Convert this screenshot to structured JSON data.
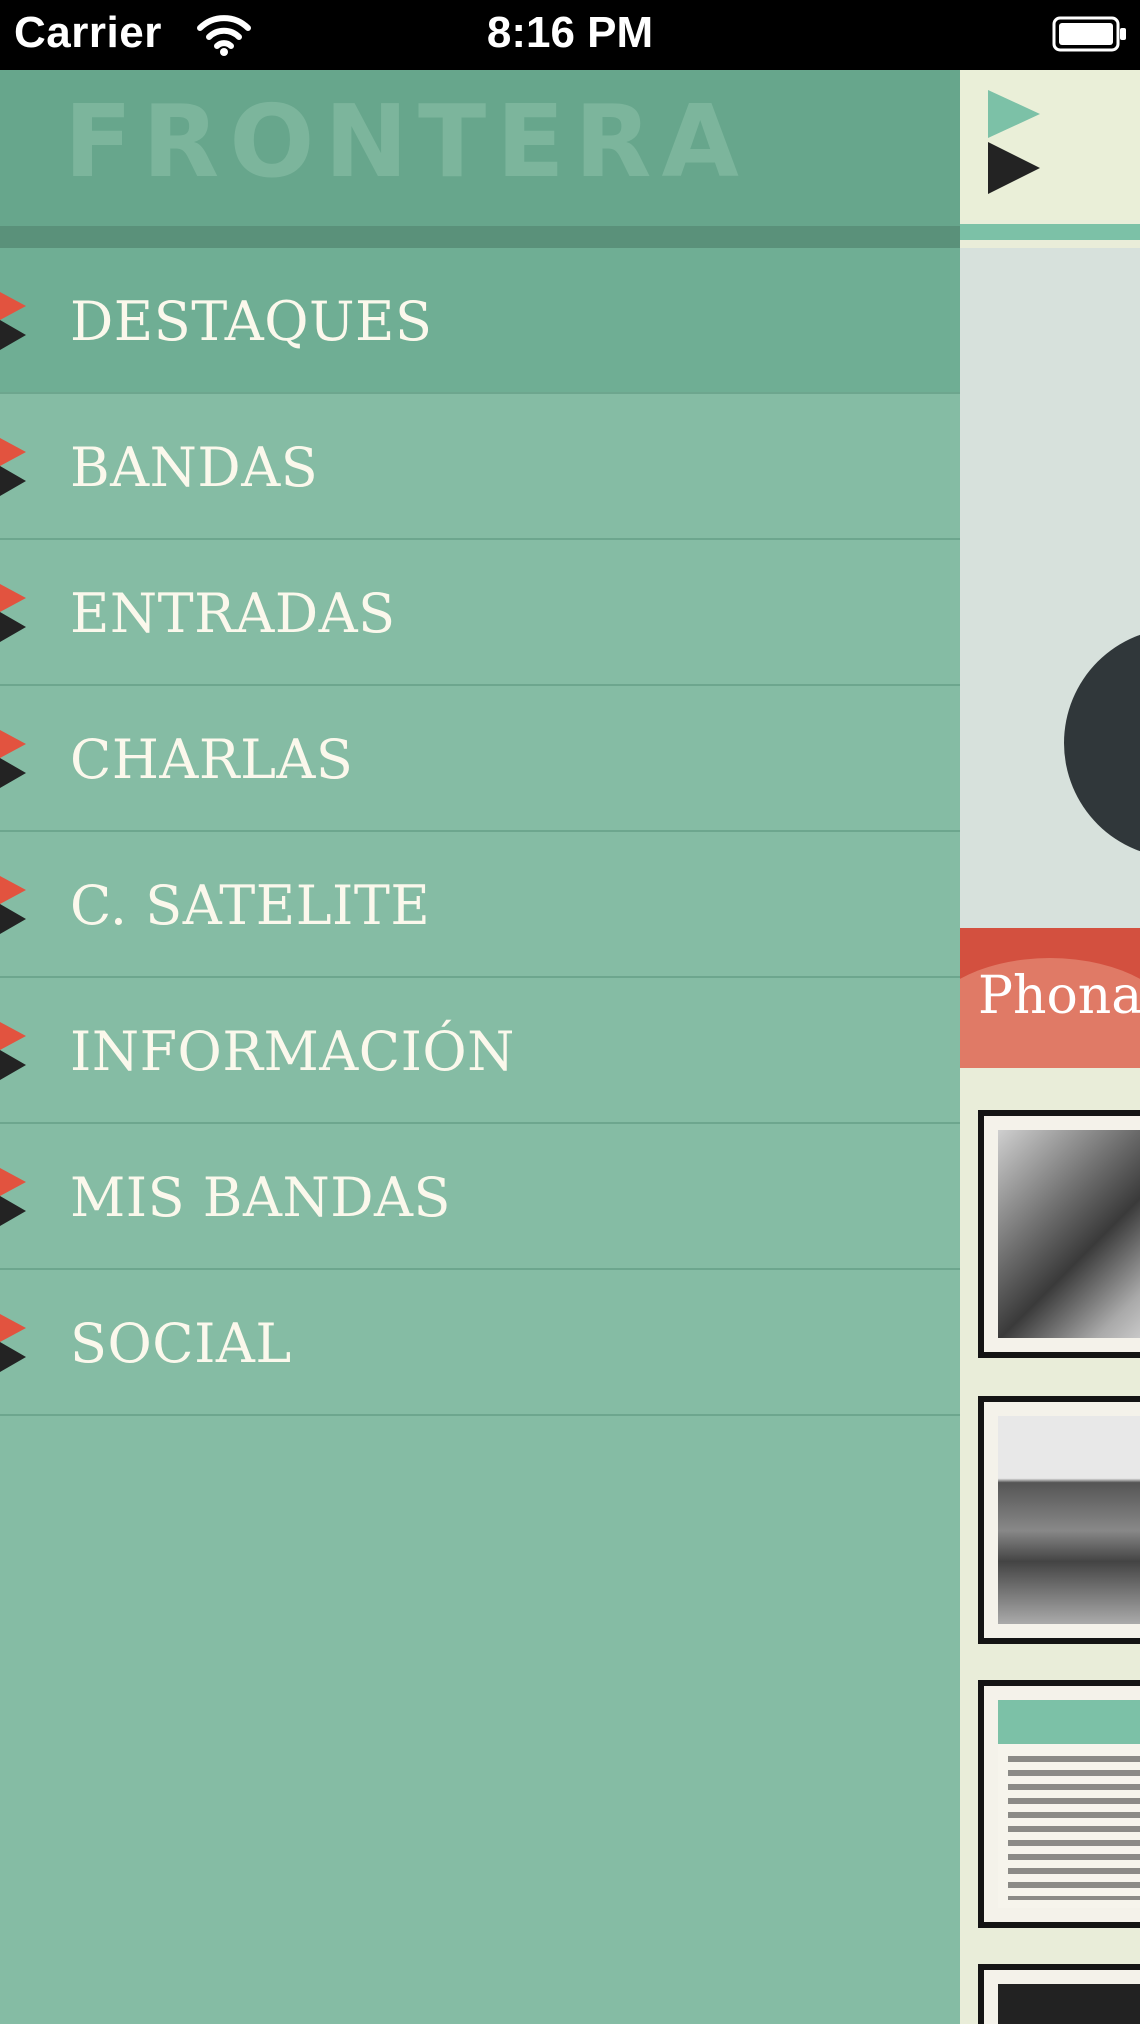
{
  "status_bar": {
    "carrier": "Carrier",
    "time": "8:16 PM",
    "icons": [
      "wifi-icon",
      "battery-icon"
    ]
  },
  "drawer": {
    "logo_text": "FRONTERA",
    "items": [
      {
        "label": "DESTAQUES",
        "active": true
      },
      {
        "label": "BANDAS",
        "active": false
      },
      {
        "label": "ENTRADAS",
        "active": false
      },
      {
        "label": "CHARLAS",
        "active": false
      },
      {
        "label": "C. SATELITE",
        "active": false
      },
      {
        "label": "INFORMACIÓN",
        "active": false
      },
      {
        "label": "MIS BANDAS",
        "active": false
      },
      {
        "label": "SOCIAL",
        "active": false
      }
    ]
  },
  "content": {
    "hero_caption": "Phona"
  },
  "colors": {
    "drawer_bg": "#85bca4",
    "header_bg": "#67a68c",
    "active_item_bg": "#6fae94",
    "flag_red": "#e2533f",
    "flag_dark": "#232323",
    "accent_teal": "#7cc1a7",
    "caption_red": "#d3503f"
  }
}
